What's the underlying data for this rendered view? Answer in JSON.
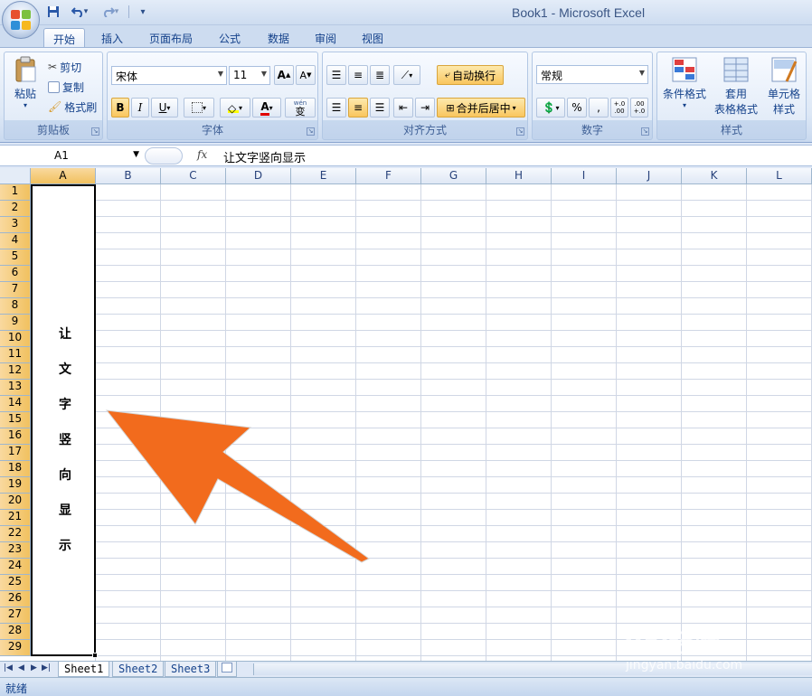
{
  "window": {
    "title": "Book1 - Microsoft Excel"
  },
  "qat": {
    "dropdown_glyph": "▾",
    "customize_glyph": "▾"
  },
  "tabs": [
    {
      "label": "开始"
    },
    {
      "label": "插入"
    },
    {
      "label": "页面布局"
    },
    {
      "label": "公式"
    },
    {
      "label": "数据"
    },
    {
      "label": "审阅"
    },
    {
      "label": "视图"
    }
  ],
  "ribbon": {
    "clipboard": {
      "label": "剪贴板",
      "paste": "粘贴",
      "cut": "剪切",
      "copy": "复制",
      "format_painter": "格式刷"
    },
    "font": {
      "label": "字体",
      "font_name": "宋体",
      "font_size": "11",
      "bold": "B",
      "italic": "I",
      "underline": "U",
      "grow": "A",
      "shrink": "A",
      "wen": "wén",
      "wen_char": "变",
      "font_color_letter": "A"
    },
    "alignment": {
      "label": "对齐方式",
      "wrap_text": "自动换行",
      "merge_center": "合并后居中"
    },
    "number": {
      "label": "数字",
      "format": "常规",
      "percent": "%",
      "comma": ",",
      "inc_decimal": "+.0 .00",
      "dec_decimal": ".00 +.0"
    },
    "styles": {
      "label": "样式",
      "conditional": "条件格式",
      "table_format_1": "套用",
      "table_format_2": "表格格式",
      "cell_style_1": "单元格",
      "cell_style_2": "样式"
    }
  },
  "formula_bar": {
    "name_box": "A1",
    "fx": "fx",
    "content": "让文字竖向显示"
  },
  "columns": [
    "A",
    "B",
    "C",
    "D",
    "E",
    "F",
    "G",
    "H",
    "I",
    "J",
    "K",
    "L"
  ],
  "rows": [
    "1",
    "2",
    "3",
    "4",
    "5",
    "6",
    "7",
    "8",
    "9",
    "10",
    "11",
    "12",
    "13",
    "14",
    "15",
    "16",
    "17",
    "18",
    "19",
    "20",
    "21",
    "22",
    "23",
    "24",
    "25",
    "26",
    "27",
    "28",
    "29"
  ],
  "cell_a1_chars": [
    "让",
    "文",
    "字",
    "竖",
    "向",
    "显",
    "示"
  ],
  "sheets": [
    "Sheet1",
    "Sheet2",
    "Sheet3"
  ],
  "status": {
    "text": "就绪"
  },
  "watermark": {
    "main": "Bai经验",
    "sub": "jingyan.baidu.com"
  },
  "colors": {
    "arrow": "#f26b1d",
    "selected_header": "#f1c15f",
    "ribbon_bg": "#dde8f6"
  }
}
